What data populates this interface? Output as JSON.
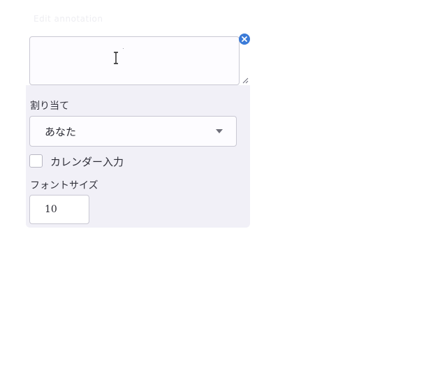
{
  "widget": {
    "title": "Edit annotation",
    "textarea_value": "",
    "assign_label": "割り当て",
    "assign_selected": "あなた",
    "calendar_label": "カレンダー入力",
    "calendar_checked": false,
    "font_size_label": "フォントサイズ",
    "font_size_value": "10"
  },
  "icons": {
    "close": "close-icon",
    "dropdown": "chevron-down-icon",
    "resize": "resize-grip-icon",
    "cursor": "text-cursor-icon"
  },
  "colors": {
    "panel_bg": "#f1f0f7",
    "accent": "#3b7bd8",
    "border": "#c9c8d3"
  }
}
